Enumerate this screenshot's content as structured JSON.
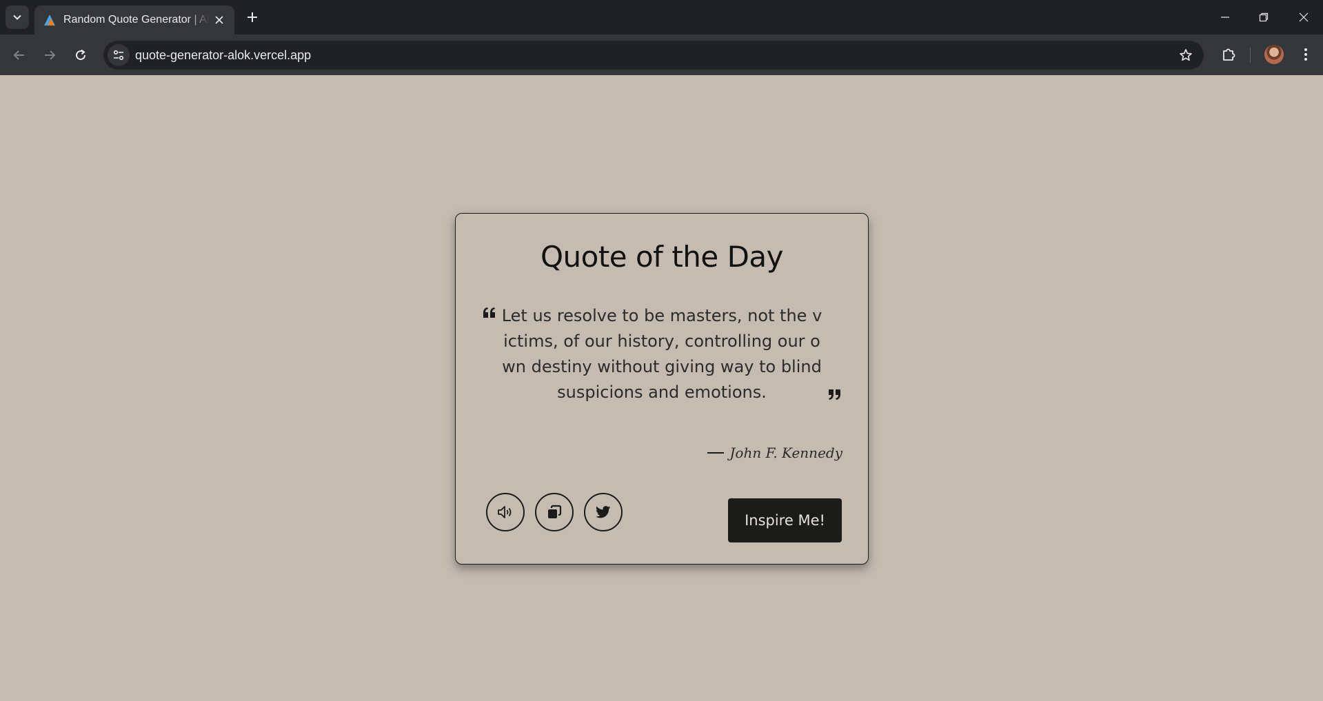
{
  "browser": {
    "tab_title": "Random Quote Generator | Alok Kumar",
    "url": "quote-generator-alok.vercel.app"
  },
  "card": {
    "title": "Quote of the Day",
    "quote": "Let us resolve to be masters, not the victims, of our history, controlling our own destiny without giving way to blind suspicions and emotions.",
    "author": "John F. Kennedy",
    "inspire_label": "Inspire Me!"
  },
  "icons": {
    "speak": "speaker-icon",
    "copy": "copy-icon",
    "tweet": "twitter-icon"
  },
  "colors": {
    "page_background": "#c5bbb1",
    "button_dark": "#1b1b1a",
    "chrome_dark": "#202124"
  }
}
